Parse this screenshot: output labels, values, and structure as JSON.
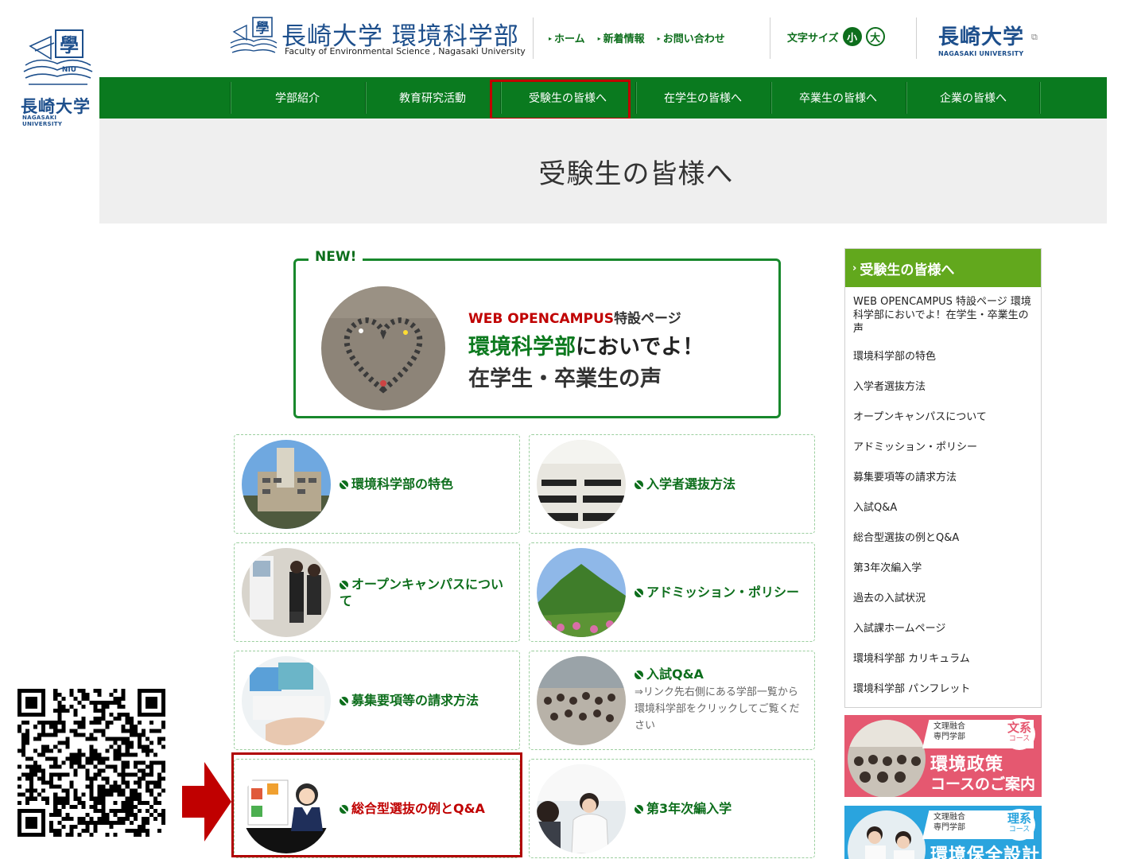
{
  "uni_logo": {
    "ja": "長崎大学",
    "en": "NAGASAKI UNIVERSITY"
  },
  "header": {
    "faculty_ja": "長崎大学 環境科学部",
    "faculty_en": "Faculty of Environmental Science , Nagasaki University",
    "links": [
      "ホーム",
      "新着情報",
      "お問い合わせ"
    ],
    "fontsize_label": "文字サイズ",
    "fontsize_small": "小",
    "fontsize_large": "大",
    "uni_ja": "長崎大学",
    "uni_en": "NAGASAKI UNIVERSITY"
  },
  "nav": {
    "items": [
      "学部紹介",
      "教育研究活動",
      "受験生の皆様へ",
      "在学生の皆様へ",
      "卒業生の皆様へ",
      "企業の皆様へ"
    ],
    "active": "受験生の皆様へ"
  },
  "page_title": "受験生の皆様へ",
  "banner": {
    "tag": "NEW!",
    "line1_red": "WEB OPENCAMPUS",
    "line1_rest": "特設ページ",
    "line2_green": "環境科学部",
    "line2_rest": "においでよ！",
    "line3": "在学生・卒業生の声"
  },
  "cards": [
    {
      "label": "環境科学部の特色"
    },
    {
      "label": "入学者選抜方法"
    },
    {
      "label": "オープンキャンパスについて"
    },
    {
      "label": "アドミッション・ポリシー"
    },
    {
      "label": "募集要項等の請求方法"
    },
    {
      "label": "入試Q&A",
      "sub": "⇒リンク先右側にある学部一覧から環境科学部をクリックしてご覧ください"
    },
    {
      "label": "総合型選抜の例とQ&A"
    },
    {
      "label": "第3年次編入学"
    }
  ],
  "sidebar": {
    "title": "受験生の皆様へ",
    "items": [
      "WEB OPENCAMPUS 特設ページ 環境科学部においでよ！在学生・卒業生の声",
      "環境科学部の特色",
      "入学者選抜方法",
      "オープンキャンパスについて",
      "アドミッション・ポリシー",
      "募集要項等の請求方法",
      "入試Q&A",
      "総合型選抜の例とQ&A",
      "第3年次編入学",
      "過去の入試状況",
      "入試課ホームページ",
      "環境科学部 カリキュラム",
      "環境科学部 パンフレット"
    ]
  },
  "promos": [
    {
      "small1": "文理融合",
      "small2": "専門学部",
      "course": "文系",
      "course_sub": "コース",
      "big": "環境政策",
      "big2": "コースのご案内"
    },
    {
      "small1": "文理融合",
      "small2": "専門学部",
      "course": "理系",
      "course_sub": "コース",
      "big": "環境保全設計"
    }
  ],
  "colors": {
    "nav_green": "#0a7a1f",
    "link_green": "#0d6e1c",
    "highlight_red": "#c00000",
    "sidebar_head": "#62a81d",
    "promo_pink": "#e55870",
    "promo_blue": "#2aa4de"
  }
}
